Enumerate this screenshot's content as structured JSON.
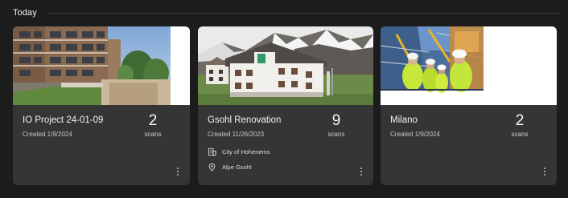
{
  "section": {
    "title": "Today"
  },
  "projects": [
    {
      "title": "IO Project 24-01-09",
      "created": "Created 1/9/2024",
      "scans_count": "2",
      "scans_label": "scans"
    },
    {
      "title": "Gsohl Renovation",
      "created": "Created 11/26/2023",
      "scans_count": "9",
      "scans_label": "scans",
      "client": "City of Hohenems",
      "location": "Alpe Gsohl"
    },
    {
      "title": "Milano",
      "created": "Created 1/9/2024",
      "scans_count": "2",
      "scans_label": "scans"
    }
  ],
  "colors": {
    "background": "#1c1c1c",
    "card": "#353535",
    "text": "#f2f2f2",
    "muted": "#c8c8c8"
  },
  "icons": [
    "building-icon",
    "location-pin-icon",
    "more-vertical-icon"
  ]
}
